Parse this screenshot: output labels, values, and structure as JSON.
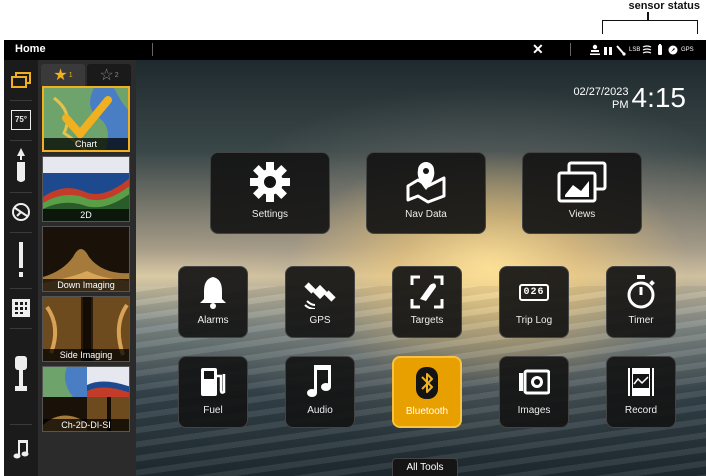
{
  "annotation": {
    "label": "sensor status"
  },
  "topbar": {
    "title": "Home",
    "close_icon": "close-icon",
    "status_icons": [
      "person-icon",
      "signal-bars-icon",
      "temperature-probe-icon",
      "depth-sensor-icon",
      "lsb-icon",
      "battery-icon",
      "compass-icon",
      "gps-icon"
    ],
    "status_labels": {
      "lsb": "LSB",
      "gps": "GPS"
    }
  },
  "sidebar": {
    "items": [
      {
        "name": "views-icon"
      },
      {
        "name": "temperature-75-icon",
        "label": "75°"
      },
      {
        "name": "boat-icon"
      },
      {
        "name": "sonar-icon"
      },
      {
        "name": "alert-icon"
      },
      {
        "name": "grid-icon"
      },
      {
        "name": "motor-icon"
      },
      {
        "name": "music-icon"
      }
    ]
  },
  "favorites": {
    "tab1": {
      "star": "★",
      "number": "1"
    },
    "tab2": {
      "star": "☆",
      "number": "2"
    },
    "thumbnails": [
      {
        "label": "Chart"
      },
      {
        "label": "2D"
      },
      {
        "label": "Down Imaging"
      },
      {
        "label": "Side Imaging"
      },
      {
        "label": "Ch-2D-DI-SI"
      }
    ]
  },
  "clock": {
    "date": "02/27/2023",
    "ampm": "PM",
    "time": "4:15"
  },
  "tiles_top": [
    {
      "label": "Settings",
      "icon": "gear-icon"
    },
    {
      "label": "Nav Data",
      "icon": "map-pin-icon"
    },
    {
      "label": "Views",
      "icon": "views-icon"
    }
  ],
  "tiles_mid": [
    {
      "label": "Alarms",
      "icon": "bell-icon"
    },
    {
      "label": "GPS",
      "icon": "satellite-icon"
    },
    {
      "label": "Targets",
      "icon": "target-icon"
    },
    {
      "label": "Trip Log",
      "icon": "trip-log-icon",
      "counter": "026"
    },
    {
      "label": "Timer",
      "icon": "stopwatch-icon"
    }
  ],
  "tiles_bot": [
    {
      "label": "Fuel",
      "icon": "fuel-icon"
    },
    {
      "label": "Audio",
      "icon": "music-icon"
    },
    {
      "label": "Bluetooth",
      "icon": "bluetooth-icon"
    },
    {
      "label": "Images",
      "icon": "camera-icon"
    },
    {
      "label": "Record",
      "icon": "record-icon"
    }
  ],
  "all_tools": "All Tools",
  "colors": {
    "accent": "#f0b020",
    "bluetooth_tile": "#e8a000"
  }
}
